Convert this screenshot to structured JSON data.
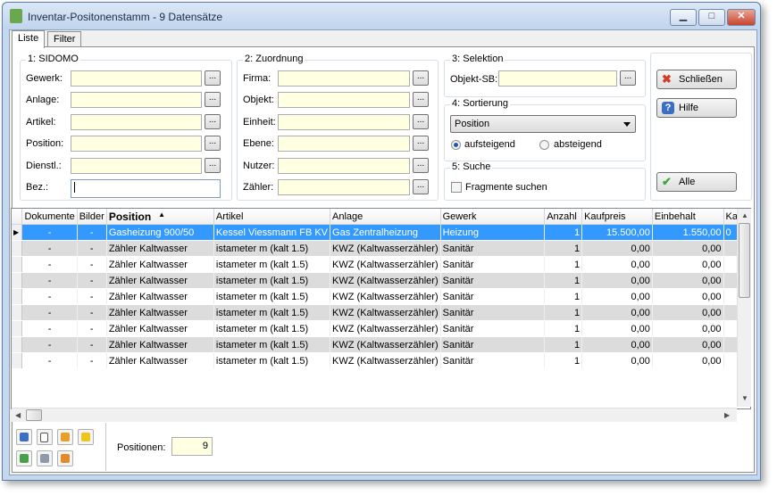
{
  "window": {
    "title": "Inventar-Positonenstamm - 9 Datensätze",
    "minimize": "▁",
    "maximize": "□",
    "close": "✕"
  },
  "tabs": [
    {
      "label": "Liste"
    },
    {
      "label": "Filter"
    }
  ],
  "sidomo": {
    "title": "1: SIDOMO",
    "fields": [
      {
        "label": "Gewerk:",
        "value": ""
      },
      {
        "label": "Anlage:",
        "value": ""
      },
      {
        "label": "Artikel:",
        "value": ""
      },
      {
        "label": "Position:",
        "value": ""
      },
      {
        "label": "Dienstl.:",
        "value": ""
      },
      {
        "label": "Bez.:",
        "value": ""
      }
    ]
  },
  "zuordnung": {
    "title": "2: Zuordnung",
    "fields": [
      {
        "label": "Firma:",
        "value": ""
      },
      {
        "label": "Objekt:",
        "value": ""
      },
      {
        "label": "Einheit:",
        "value": ""
      },
      {
        "label": "Ebene:",
        "value": ""
      },
      {
        "label": "Nutzer:",
        "value": ""
      },
      {
        "label": "Zähler:",
        "value": ""
      }
    ]
  },
  "selektion": {
    "title": "3: Selektion",
    "label": "Objekt-SB:",
    "value": ""
  },
  "sortierung": {
    "title": "4: Sortierung",
    "selected": "Position",
    "asc": "aufsteigend",
    "desc": "absteigend",
    "order": "aufsteigend"
  },
  "suche": {
    "title": "5: Suche",
    "fragment_label": "Fragmente suchen",
    "fragment_checked": false
  },
  "ellipsis": "...",
  "buttons": {
    "schliessen": "Schließen",
    "hilfe": "Hilfe",
    "alle": "Alle"
  },
  "grid": {
    "columns": [
      "Dokumente",
      "Bilder",
      "Position",
      "Artikel",
      "Anlage",
      "Gewerk",
      "Anzahl",
      "Kaufpreis",
      "Einbehalt",
      "Ka"
    ],
    "sorted_column": "Position",
    "rows": [
      [
        "-",
        "-",
        "Gasheizung 900/50",
        "Kessel Viessmann FB KV",
        "Gas Zentralheizung",
        "Heizung",
        "1",
        "15.500,00",
        "1.550,00",
        "0"
      ],
      [
        "-",
        "-",
        "Zähler Kaltwasser",
        "istameter m (kalt 1.5)",
        "KWZ (Kaltwasserzähler)",
        "Sanitär",
        "1",
        "0,00",
        "0,00",
        ""
      ],
      [
        "-",
        "-",
        "Zähler Kaltwasser",
        "istameter m (kalt 1.5)",
        "KWZ (Kaltwasserzähler)",
        "Sanitär",
        "1",
        "0,00",
        "0,00",
        ""
      ],
      [
        "-",
        "-",
        "Zähler Kaltwasser",
        "istameter m (kalt 1.5)",
        "KWZ (Kaltwasserzähler)",
        "Sanitär",
        "1",
        "0,00",
        "0,00",
        ""
      ],
      [
        "-",
        "-",
        "Zähler Kaltwasser",
        "istameter m (kalt 1.5)",
        "KWZ (Kaltwasserzähler)",
        "Sanitär",
        "1",
        "0,00",
        "0,00",
        ""
      ],
      [
        "-",
        "-",
        "Zähler Kaltwasser",
        "istameter m (kalt 1.5)",
        "KWZ (Kaltwasserzähler)",
        "Sanitär",
        "1",
        "0,00",
        "0,00",
        ""
      ],
      [
        "-",
        "-",
        "Zähler Kaltwasser",
        "istameter m (kalt 1.5)",
        "KWZ (Kaltwasserzähler)",
        "Sanitär",
        "1",
        "0,00",
        "0,00",
        ""
      ],
      [
        "-",
        "-",
        "Zähler Kaltwasser",
        "istameter m (kalt 1.5)",
        "KWZ (Kaltwasserzähler)",
        "Sanitär",
        "1",
        "0,00",
        "0,00",
        ""
      ],
      [
        "-",
        "-",
        "Zähler Kaltwasser",
        "istameter m (kalt 1.5)",
        "KWZ (Kaltwasserzähler)",
        "Sanitär",
        "1",
        "0,00",
        "0,00",
        ""
      ]
    ],
    "selected_row": 0
  },
  "footer": {
    "positionen_label": "Positionen:",
    "positionen_value": "9"
  },
  "colors": {
    "selection": "#3399ff",
    "field_bg": "#ffffe1",
    "row_alt": "#dcdcdc"
  }
}
